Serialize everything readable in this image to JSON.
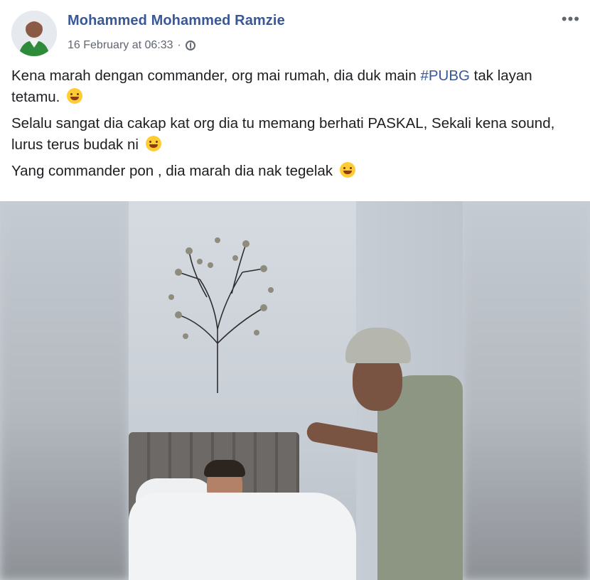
{
  "post": {
    "author": "Mohammed Mohammed Ramzie",
    "timestamp": "16 February at 06:33",
    "separator": "·",
    "privacy_icon": "globe-icon",
    "more_label": "•••",
    "paragraphs": [
      {
        "before": "Kena marah dengan commander, org mai rumah, dia duk main ",
        "hashtag": "#PUBG",
        "after": " tak layan tetamu."
      },
      {
        "text": "Selalu sangat dia cakap kat org dia tu memang berhati PASKAL, Sekali kena sound, lurus terus budak ni"
      },
      {
        "text": "Yang commander pon , dia marah dia nak tegelak"
      }
    ]
  },
  "colors": {
    "link": "#385898",
    "text": "#1c1e21",
    "meta": "#606770"
  }
}
